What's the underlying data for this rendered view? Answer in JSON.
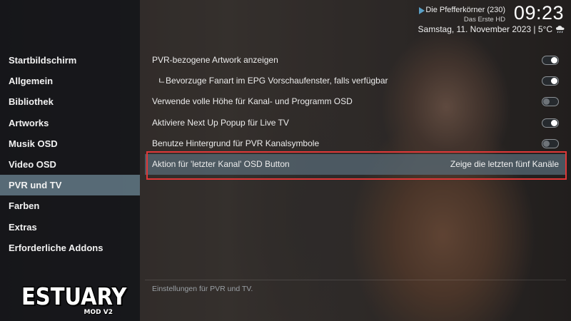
{
  "header": {
    "now_playing": "Die Pfefferkörner (230)",
    "channel": "Das Erste HD",
    "time": "09:23",
    "date_weather": "Samstag, 11. November 2023 | 5°C",
    "weather_icon": "cloud-rain-icon"
  },
  "sidebar": {
    "items": [
      {
        "label": "Startbildschirm"
      },
      {
        "label": "Allgemein"
      },
      {
        "label": "Bibliothek"
      },
      {
        "label": "Artworks"
      },
      {
        "label": "Musik OSD"
      },
      {
        "label": "Video OSD"
      },
      {
        "label": "PVR und TV",
        "active": true
      },
      {
        "label": "Farben"
      },
      {
        "label": "Extras"
      },
      {
        "label": "Erforderliche Addons"
      }
    ],
    "logo_text": "ESTUARY",
    "logo_sub": "MOD V2"
  },
  "settings": {
    "rows": [
      {
        "label": "PVR-bezogene Artwork anzeigen",
        "toggle": true
      },
      {
        "label": "ㄴBevorzuge Fanart im EPG Vorschaufenster, falls verfügbar",
        "toggle": true
      },
      {
        "label": "Verwende volle Höhe für Kanal- und Programm OSD",
        "toggle": false
      },
      {
        "label": "Aktiviere Next Up Popup für Live TV",
        "toggle": true
      },
      {
        "label": "Benutze Hintergrund für PVR Kanalsymbole",
        "toggle": false
      },
      {
        "label": "Aktion für 'letzter Kanal' OSD Button",
        "value": "Zeige die letzten fünf Kanäle"
      }
    ],
    "description": "Einstellungen für PVR und TV."
  },
  "colors": {
    "accent": "#5a9fc5",
    "selected_row": "#5a6e7a",
    "highlight_border": "#e03838"
  }
}
